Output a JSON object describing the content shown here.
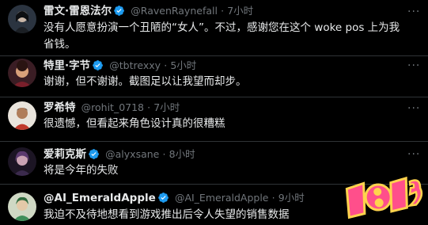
{
  "tweets": [
    {
      "name": "雷文·雷恩法尔",
      "handle": "@RavenRaynefall",
      "separator": "·",
      "time": "7小时",
      "text": "没有人愿意扮演一个丑陋的“女人”。不过，感谢您在这个 woke pos 上为我省钱。"
    },
    {
      "name": "特里·字节",
      "handle": "@tbtrexxy",
      "separator": "·",
      "time": "5小时",
      "text": "谢谢，但不谢谢。截图足以让我望而却步。"
    },
    {
      "name": "罗希特",
      "handle": "@rohit_0718",
      "separator": "·",
      "time": "7小时",
      "text": "很遗憾，但看起来角色设计真的很糟糕"
    },
    {
      "name": "爱莉克斯",
      "handle": "@alyxsane",
      "separator": "·",
      "time": "8小时",
      "text": "将是今年的失败"
    },
    {
      "name": "@AI_EmeraldApple",
      "handle": "@AI_EmeraldApple",
      "separator": "·",
      "time": "9小时",
      "text": "我迫不及待地想看到游戏推出后令人失望的销售数据"
    }
  ],
  "more_label": "···",
  "colors": {
    "background": "#000000",
    "text": "#e7e9ea",
    "muted": "#71767b",
    "verified": "#1d9bf0",
    "divider": "#2f3336",
    "watermark_pink": "#ff4f8b",
    "watermark_yellow": "#ffd34d"
  }
}
